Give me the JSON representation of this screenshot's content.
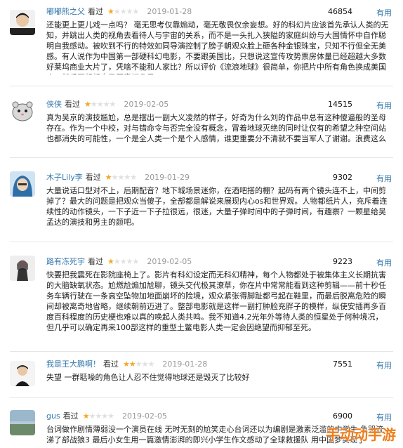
{
  "reviews": [
    {
      "user": "嘟嘟熊之父",
      "watched": "看过",
      "rating": 1,
      "date": "2019-01-28",
      "votes": "46854",
      "useful": "有用",
      "avatar": "person-avatar",
      "text": "还能更上更儿戏一点吗？ 毫无思考仅靠煽动，毫无敬畏仅余妄想。好的科幻片应该首先承认人类的无知，并跳出人类的视角去看待人与宇宙的关系，而不是一头扎入狭隘的家庭纠纷与大国情怀中自作聪明自我感动。被吹到不行的特效如同导演控制了膀子朝观众脸上砸各种金银珠宝，只知不行但全无美感。有人说作为中国第一部硬科幻电影，不要跟美国比，只想说这宣传攻势票房体量已经超越大多数好莱坞商业大片了，凭啥不能和人家比？所以评价《流浪地球》很简单，你把片中所有角色换成美国人，然后再想想自己愿意打几星。"
    },
    {
      "user": "侠侠",
      "watched": "看过",
      "rating": 1,
      "date": "2019-02-05",
      "votes": "14515",
      "useful": "有用",
      "avatar": "hamster-avatar",
      "text": "真为吴京的演技尴尬，总是摆出一副大义凌然的样子，好奇为什么刘的作品中总有这种傻逼般的圣母存在。作为一个中校，对与错命令与否完全没有概念，冒着地球灭绝的同时让仅有的希望之种空间站也都消失的可能性，一个是全人类一个是个人感情，谁更重要分不清就不要当军人了谢谢。浪费这么好的题材设定，吐"
    },
    {
      "user": "木子Lily李",
      "watched": "看过",
      "rating": 1,
      "date": "2019-01-29",
      "votes": "9302",
      "useful": "有用",
      "avatar": "hooded-person-avatar",
      "text": "大量说话口型对不上，后期配音？地下城场景迷你，在酒吧搭的棚？起码有两个镜头连不上，中间剪掉了？最大的问题是把观众当傻子，全部都是解说来展现内心os和世界观。人物都纸片人，充斥着连续性的动作镜头，一下子近一下子拉很远，很迷，大量子弹时间中的子弹时间，有趣察？一颗星给吴孟达的演技和男主的颜吧。"
    },
    {
      "user": "路有冻死宇",
      "watched": "看过",
      "rating": 1,
      "date": "2019-02-05",
      "votes": "9223",
      "useful": "有用",
      "avatar": "woman-portrait-avatar",
      "text": "快要把我震死在影院座椅上了。影片有科幻设定而无科幻精神，每个人物都处于被集体主义长期抗害的大脑缺氧状态。尬燃尬煽加尬聊，镜头交代极其潦草，你在片中常常能看到这种剪辑——前十秒任务车辆行驶在一条高空坠物加地面崩坏的险境，观众紧张得脚趾都弓起在鞋里，而最后脱离危险的瞬间却被离奇地省略，继续朝前迈进了。整部电影就是这样一副打肿脸充胖子的模样，纵使安插再多百度百科程度的历史梗也难以真的唤起人类共鸣。我不知道4.2光年外等待人类的恒星处于何种境况，但几乎可以确定再来100部这样的重型土鳖电影人类一定会因绝望而抑郁至死。"
    },
    {
      "user": "我是王大鹏啊！",
      "watched": "看过",
      "rating": 2,
      "date": "2019-01-28",
      "votes": "7551",
      "useful": "有用",
      "avatar": "short-hair-avatar",
      "text": "失望 一群聒噪的角色让人忍不住觉得地球还是毁灭了比较好"
    },
    {
      "user": "gus",
      "watched": "看过",
      "rating": 1,
      "date": "2019-02-05",
      "votes": "6900",
      "useful": "有用",
      "avatar": "landscape-avatar",
      "text": "台词做作剧情薄弱没一个演员在线 无时无刻的尬笑走心台词还以为编剧是激素泛滥的中学生 急哭流涕了部战狼3 最后小女生用一篇激情澎湃的即兴小学生作文感动了全球救援队 用中国梦实现了"
    }
  ],
  "watermark": "手动动手游"
}
